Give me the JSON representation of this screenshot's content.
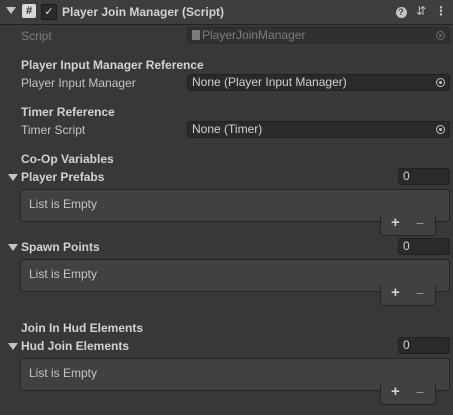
{
  "header": {
    "script_icon": "#",
    "check": "✓",
    "title": "Player Join Manager (Script)",
    "help_icon": "?",
    "presets_icon": "⇵",
    "menu_icon": "⋮"
  },
  "script_row": {
    "label": "Script",
    "value": "PlayerJoinManager"
  },
  "player_input_section": {
    "heading": "Player Input Manager Reference",
    "label": "Player Input Manager",
    "value": "None (Player Input Manager)"
  },
  "timer_section": {
    "heading": "Timer Reference",
    "label": "Timer Script",
    "value": "None (Timer)"
  },
  "coop_heading": "Co-Op Variables",
  "lists": {
    "player_prefabs": {
      "label": "Player Prefabs",
      "size": "0",
      "empty": "List is Empty"
    },
    "spawn_points": {
      "label": "Spawn Points",
      "size": "0",
      "empty": "List is Empty"
    },
    "hud_join_elements": {
      "label": "Hud Join Elements",
      "size": "0",
      "empty": "List is Empty"
    }
  },
  "hud_heading": "Join In Hud Elements",
  "list_controls": {
    "add": "+",
    "remove": "−"
  }
}
